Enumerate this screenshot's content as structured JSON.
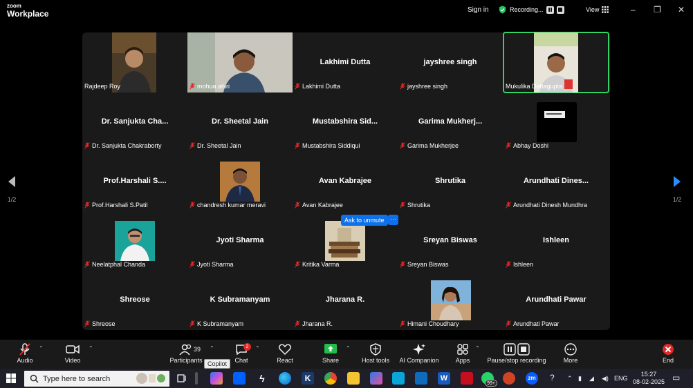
{
  "app": {
    "brand_top": "zoom",
    "brand_bottom": "Workplace"
  },
  "titlebar": {
    "sign_in": "Sign in",
    "recording": "Recording...",
    "view": "View",
    "minimize": "–",
    "restore": "❐",
    "close": "✕"
  },
  "gallery": {
    "page_left": "1/2",
    "page_right": "1/2",
    "tiles": [
      {
        "name": "Rajdeep Roy",
        "display": "",
        "muted": false,
        "video": true
      },
      {
        "name": "mohua ahiri",
        "display": "",
        "muted": true,
        "video": true
      },
      {
        "name": "Lakhimi Dutta",
        "display": "Lakhimi Dutta",
        "muted": true,
        "video": false
      },
      {
        "name": "jayshree singh",
        "display": "jayshree singh",
        "muted": true,
        "video": false
      },
      {
        "name": "Mukulika Dattagupta",
        "display": "",
        "muted": false,
        "video": true,
        "active": true
      },
      {
        "name": "Dr. Sanjukta Chakraborty",
        "display": "Dr. Sanjukta Cha...",
        "muted": true,
        "video": false
      },
      {
        "name": "Dr. Sheetal Jain",
        "display": "Dr. Sheetal Jain",
        "muted": true,
        "video": false
      },
      {
        "name": "Mustabshira Siddiqui",
        "display": "Mustabshira Sid...",
        "muted": true,
        "video": false
      },
      {
        "name": "Garima Mukherjee",
        "display": "Garima Mukherj...",
        "muted": true,
        "video": false
      },
      {
        "name": "Abhay Doshi",
        "display": "",
        "muted": true,
        "video": true
      },
      {
        "name": "Prof.Harshali S.Patil",
        "display": "Prof.Harshali S....",
        "muted": true,
        "video": false
      },
      {
        "name": "chandresh kumar meravi",
        "display": "",
        "muted": true,
        "video": true
      },
      {
        "name": "Avan Kabrajee",
        "display": "Avan Kabrajee",
        "muted": true,
        "video": false
      },
      {
        "name": "Shrutika",
        "display": "Shrutika",
        "muted": true,
        "video": false
      },
      {
        "name": "Arundhati Dinesh Mundhra",
        "display": "Arundhati Dines...",
        "muted": true,
        "video": false
      },
      {
        "name": "Neelatphal Chanda",
        "display": "",
        "muted": true,
        "video": true
      },
      {
        "name": "Jyoti Sharma",
        "display": "Jyoti Sharma",
        "muted": true,
        "video": false
      },
      {
        "name": "Kritika Varma",
        "display": "",
        "muted": true,
        "video": true
      },
      {
        "name": "Sreyan Biswas",
        "display": "Sreyan Biswas",
        "muted": true,
        "video": false
      },
      {
        "name": "Ishleen",
        "display": "Ishleen",
        "muted": true,
        "video": false
      },
      {
        "name": "Shreose",
        "display": "Shreose",
        "muted": true,
        "video": false
      },
      {
        "name": "K Subramanyam",
        "display": "K Subramanyam",
        "muted": true,
        "video": false
      },
      {
        "name": "Jharana R.",
        "display": "Jharana R.",
        "muted": true,
        "video": false
      },
      {
        "name": "Himani Choudhary",
        "display": "",
        "muted": true,
        "video": true
      },
      {
        "name": "Arundhati Pawar",
        "display": "Arundhati Pawar",
        "muted": true,
        "video": false
      }
    ],
    "ask_to_unmute": "Ask to unmute",
    "more_dots": "···"
  },
  "toolbar": {
    "audio": "Audio",
    "video": "Video",
    "participants": "Participants",
    "participants_count": "39",
    "copilot_tooltip": "Copilot",
    "chat": "Chat",
    "chat_badge": "2",
    "react": "React",
    "share": "Share",
    "host_tools": "Host tools",
    "ai_companion": "AI Companion",
    "apps": "Apps",
    "pause_stop_recording": "Pause/stop recording",
    "more": "More",
    "end": "End"
  },
  "taskbar": {
    "search_placeholder": "Type here to search",
    "notif_badge": "99+",
    "language": "ENG",
    "time": "15:27",
    "date": "08-02-2025"
  },
  "colors": {
    "accent_blue": "#0e71eb",
    "active_green": "#32d266",
    "mute_red": "#e02828",
    "share_green": "#1fbf4a"
  }
}
